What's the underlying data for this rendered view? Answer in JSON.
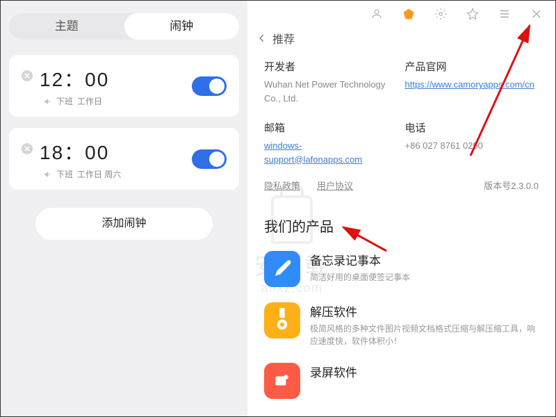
{
  "tabs": {
    "theme": "主题",
    "alarm": "闹钟"
  },
  "alarms": [
    {
      "time": "12：00",
      "label": "下班",
      "repeat": "工作日"
    },
    {
      "time": "18：00",
      "label": "下班",
      "repeat": "工作日 周六"
    }
  ],
  "add_button": "添加闹钟",
  "breadcrumb": {
    "back": "‹",
    "title": "推荐"
  },
  "details": {
    "developer_label": "开发者",
    "developer_value": "Wuhan Net Power Technology Co., Ltd.",
    "website_label": "产品官网",
    "website_value": "https://www.camoryapps.com/cn",
    "email_label": "邮箱",
    "email_value": "windows-support@lafonapps.com",
    "phone_label": "电话",
    "phone_value": "+86 027 8761 0250"
  },
  "policy": {
    "privacy": "隐私政策",
    "terms": "用户协议",
    "version": "版本号2.3.0.0"
  },
  "products_title": "我们的产品",
  "products": [
    {
      "name": "备忘录记事本",
      "desc": "简洁好用的桌面便签记事本",
      "bg": "#2f8cff"
    },
    {
      "name": "解压软件",
      "desc": "极简风格的多种文件图片视频文档格式压缩与解压缩工具，响应速度快，软件体积小！",
      "bg": "#ffb016"
    },
    {
      "name": "录屏软件",
      "desc": "",
      "bg": "#ff5a45"
    }
  ],
  "watermark": {
    "big": "安下载",
    "small": "anxz.com"
  }
}
